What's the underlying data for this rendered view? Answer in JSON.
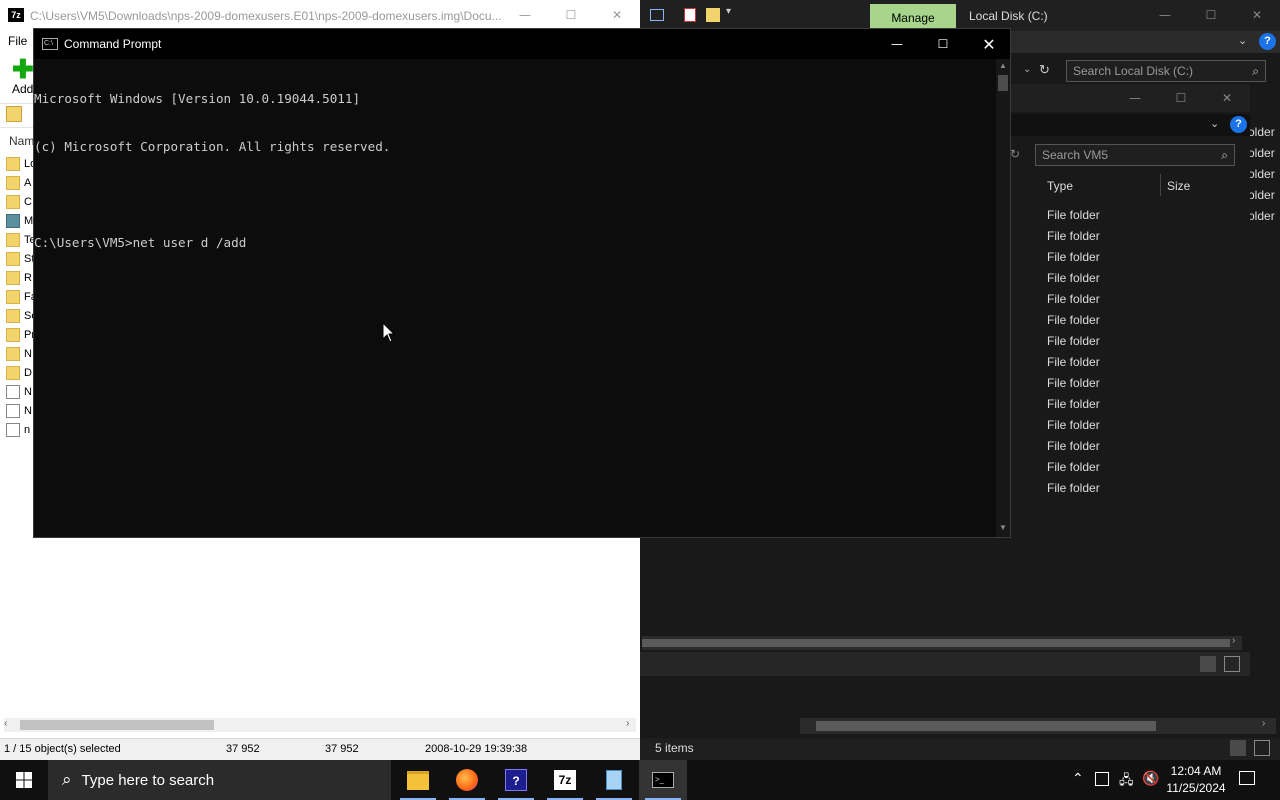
{
  "sevenzip": {
    "title": "C:\\Users\\VM5\\Downloads\\nps-2009-domexusers.E01\\nps-2009-domexusers.img\\Docu...",
    "menu_file": "File",
    "toolbar_add": "Add",
    "list_header_name": "Nam",
    "list_items": [
      {
        "label": "Lo",
        "icon": "folder-icon"
      },
      {
        "label": "A",
        "icon": "folder-icon"
      },
      {
        "label": "C",
        "icon": "folder-icon"
      },
      {
        "label": "M",
        "icon": "drive-icon"
      },
      {
        "label": "Te",
        "icon": "folder-icon"
      },
      {
        "label": "St",
        "icon": "folder-icon"
      },
      {
        "label": "R",
        "icon": "folder-icon"
      },
      {
        "label": "Fa",
        "icon": "folder-icon"
      },
      {
        "label": "Se",
        "icon": "folder-icon"
      },
      {
        "label": "Pr",
        "icon": "folder-icon"
      },
      {
        "label": "N",
        "icon": "folder-icon"
      },
      {
        "label": "D",
        "icon": "folder-icon"
      },
      {
        "label": "N",
        "icon": "file-icon"
      },
      {
        "label": "N",
        "icon": "file-icon"
      },
      {
        "label": "n",
        "icon": "file-icon"
      }
    ],
    "status": {
      "selection": "1 / 15 object(s) selected",
      "size": "37 952",
      "packed": "37 952",
      "modified": "2008-10-29 19:39:38"
    }
  },
  "explorer": {
    "manage_tab": "Manage",
    "title": "Local Disk (C:)",
    "search_placeholder": "Search Local Disk (C:)",
    "status_items": "5 items",
    "right_partial": [
      "older",
      "older",
      "older",
      "older",
      "older"
    ]
  },
  "inner_explorer": {
    "search_placeholder": "Search VM5",
    "col_type": "Type",
    "col_size": "Size",
    "rows": [
      "File folder",
      "File folder",
      "File folder",
      "File folder",
      "File folder",
      "File folder",
      "File folder",
      "File folder",
      "File folder",
      "File folder",
      "File folder",
      "File folder",
      "File folder",
      "File folder"
    ]
  },
  "cmd": {
    "title": "Command Prompt",
    "lines": [
      "Microsoft Windows [Version 10.0.19044.5011]",
      "(c) Microsoft Corporation. All rights reserved.",
      "",
      "C:\\Users\\VM5>net user d /add"
    ]
  },
  "taskbar": {
    "search_placeholder": "Type here to search",
    "time": "12:04 AM",
    "date": "11/25/2024",
    "apps": [
      "file-explorer-icon",
      "firefox-icon",
      "help-icon",
      "7zip-icon",
      "notepad-icon",
      "cmd-icon"
    ]
  },
  "colors": {
    "manage_tab": "#a6d58b",
    "cmd_bg": "#0c0c0c",
    "taskbar_bg": "#101010"
  }
}
